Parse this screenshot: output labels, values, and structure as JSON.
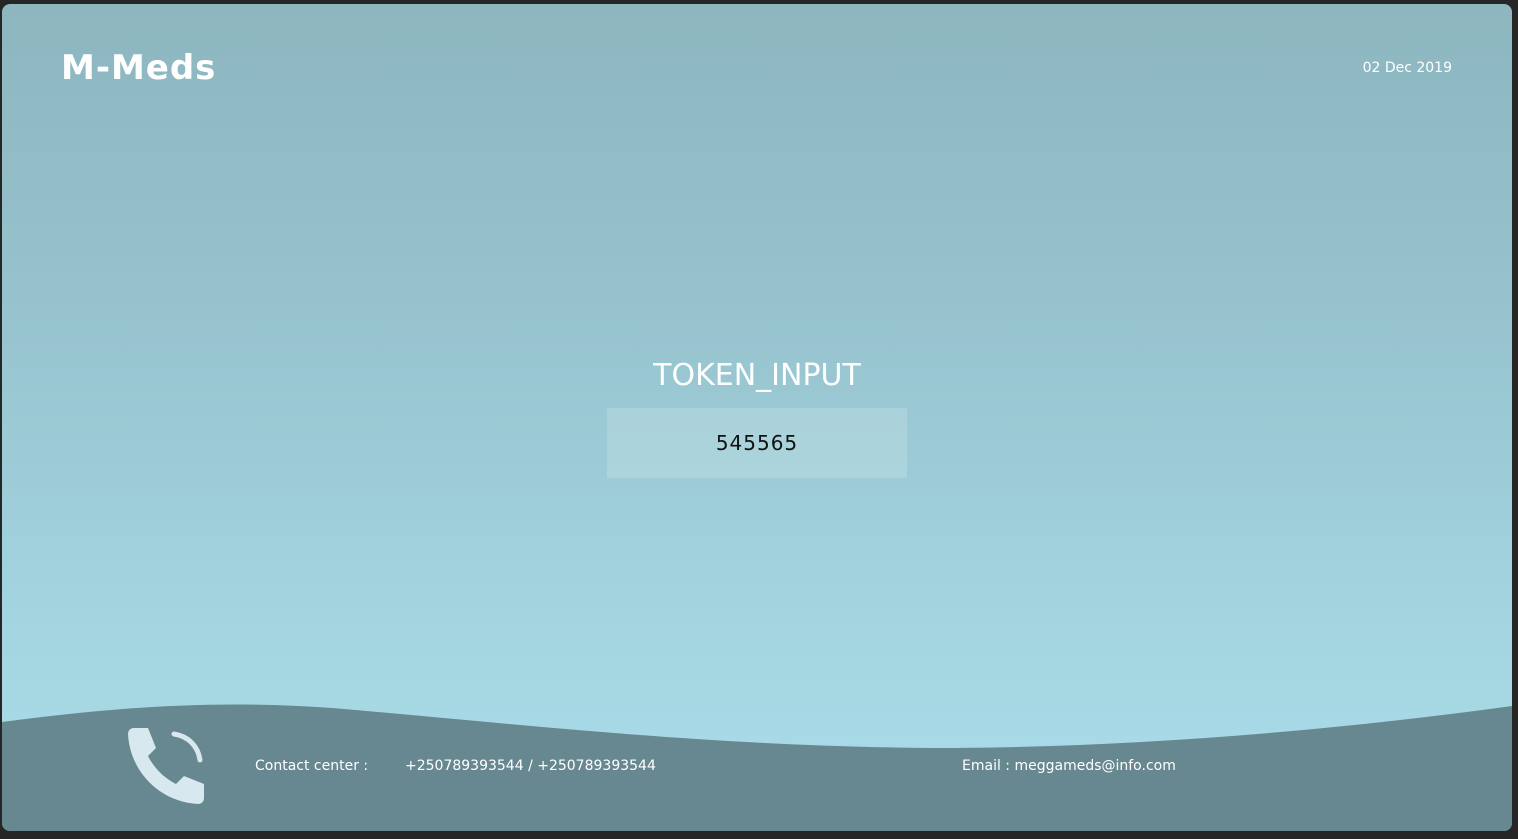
{
  "header": {
    "logo": "M-Meds",
    "date": "02 Dec 2019"
  },
  "main": {
    "title": "TOKEN_INPUT",
    "token_value": "545565"
  },
  "footer": {
    "contact_label": "Contact center :",
    "phones": "+250789393544 / +250789393544",
    "email": "Email : meggameds@info.com",
    "icon": "phone-icon"
  },
  "colors": {
    "footer_bg": "#678890",
    "icon_color": "#d7e8ee"
  }
}
